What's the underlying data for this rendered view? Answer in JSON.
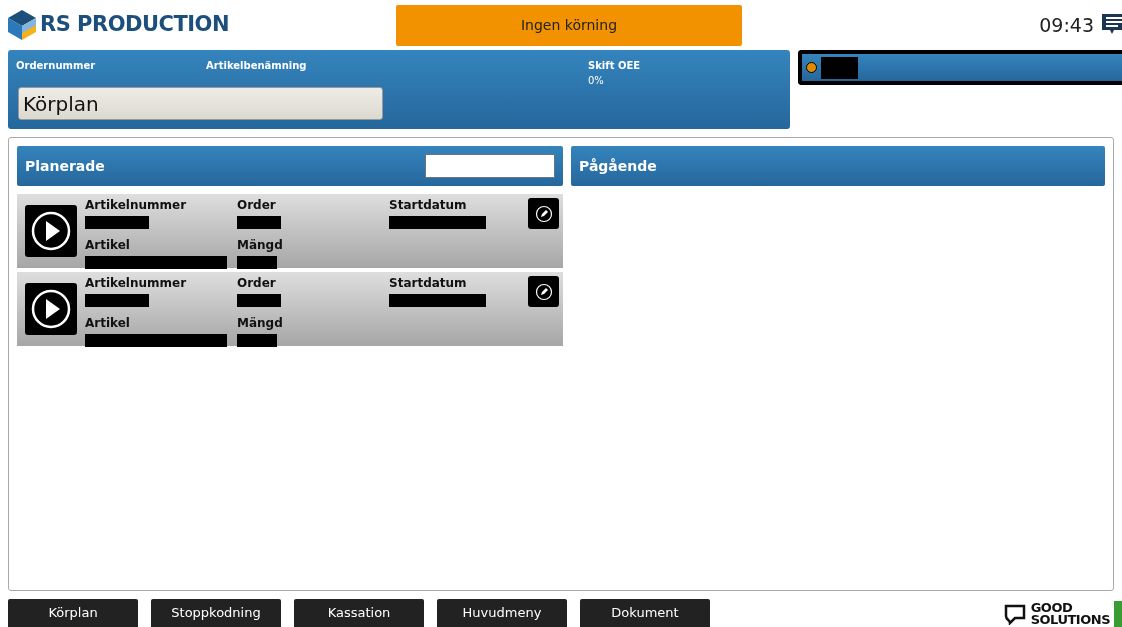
{
  "header": {
    "brand": "RS PRODUCTION",
    "status": "Ingen körning",
    "time": "09:43"
  },
  "order_panel": {
    "fields": [
      {
        "label": "Ordernummer"
      },
      {
        "label": "Artikelbenämning"
      },
      {
        "label": "Skift OEE",
        "value": "0%"
      }
    ],
    "view_button": "Körplan"
  },
  "machine_bar": {
    "running": false,
    "name_redacted": true
  },
  "planned": {
    "title": "Planerade",
    "orders": [
      {
        "fields": [
          {
            "label": "Artikelnummer",
            "redacted": true
          },
          {
            "label": "Order",
            "redacted": true
          },
          {
            "label": "Startdatum",
            "redacted": true
          },
          {
            "label": "Artikel",
            "redacted": true
          },
          {
            "label": "Mängd",
            "redacted": true
          }
        ]
      },
      {
        "fields": [
          {
            "label": "Artikelnummer",
            "redacted": true
          },
          {
            "label": "Order",
            "redacted": true
          },
          {
            "label": "Startdatum",
            "redacted": true
          },
          {
            "label": "Artikel",
            "redacted": true
          },
          {
            "label": "Mängd",
            "redacted": true
          }
        ]
      }
    ]
  },
  "ongoing": {
    "title": "Pågående"
  },
  "nav_buttons": [
    {
      "label": "Körplan"
    },
    {
      "label": "Stoppkodning"
    },
    {
      "label": "Kassation"
    },
    {
      "label": "Huvudmeny"
    },
    {
      "label": "Dokument"
    }
  ],
  "footer_logo": {
    "line1": "GOOD",
    "line2": "SOLUTIONS"
  }
}
